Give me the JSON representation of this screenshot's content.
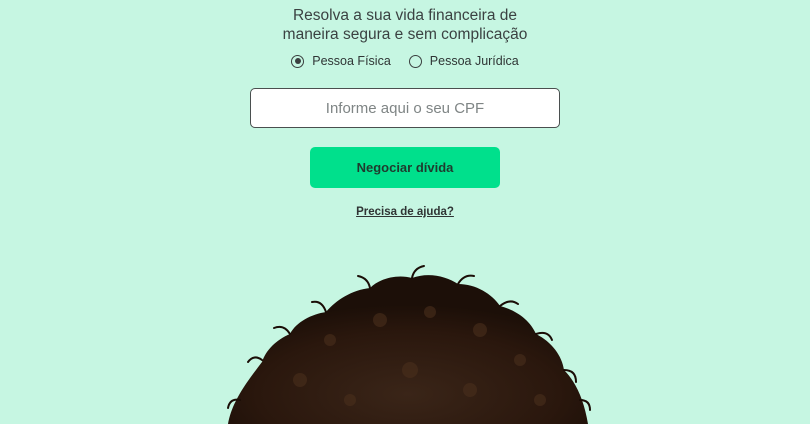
{
  "headline": {
    "line1": "Resolva a sua vida financeira de",
    "line2": "maneira segura e sem complicação"
  },
  "person_type": {
    "options": [
      {
        "label": "Pessoa Física",
        "selected": true
      },
      {
        "label": "Pessoa Jurídica",
        "selected": false
      }
    ]
  },
  "cpf_field": {
    "placeholder": "Informe aqui o seu CPF",
    "value": ""
  },
  "cta": {
    "label": "Negociar dívida"
  },
  "help": {
    "label": "Precisa de ajuda?"
  },
  "colors": {
    "background": "#c6f6e2",
    "accent": "#00e08c",
    "text": "#333a3a"
  }
}
